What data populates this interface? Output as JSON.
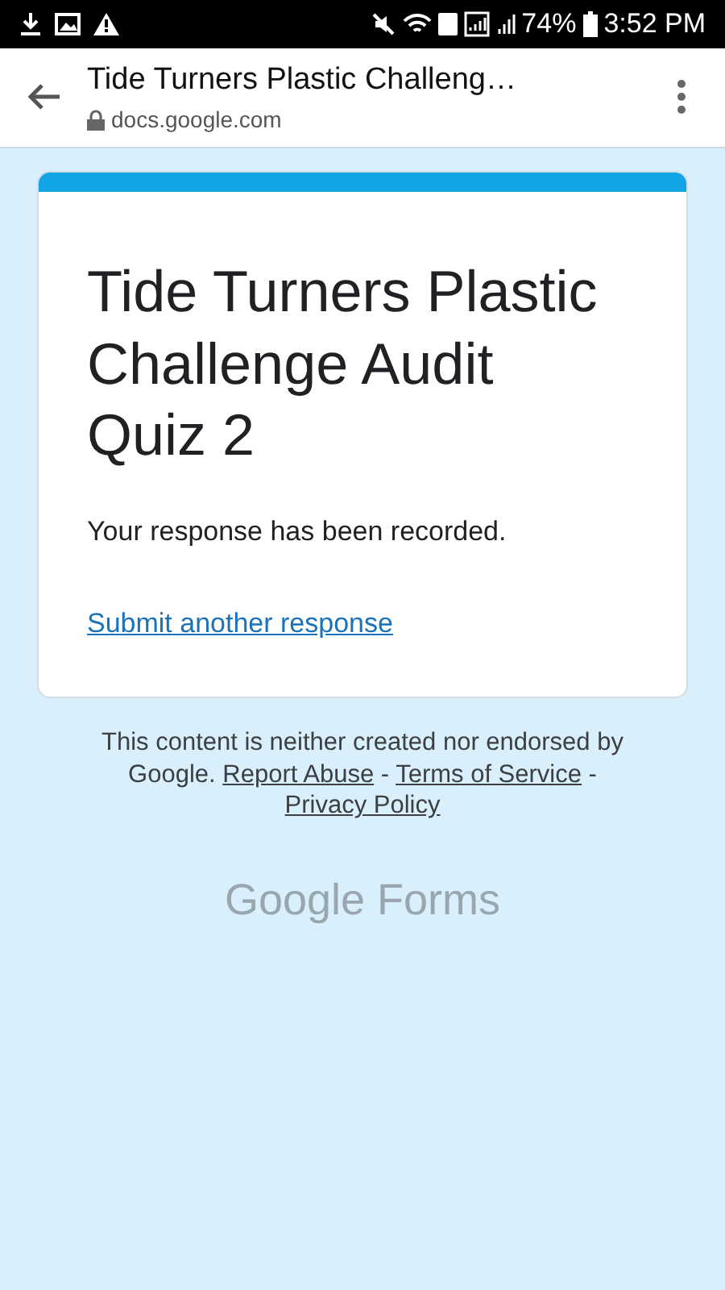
{
  "status_bar": {
    "battery": "74%",
    "time": "3:52 PM"
  },
  "browser": {
    "title": "Tide Turners Plastic Challeng…",
    "url": "docs.google.com"
  },
  "form": {
    "title": "Tide Turners Plastic Challenge Audit Quiz 2",
    "message": "Your response has been recorded.",
    "link": "Submit another response"
  },
  "footer": {
    "text": "This content is neither created nor endorsed by Google.",
    "links": [
      "Report Abuse",
      "Terms of Service",
      "Privacy Policy"
    ],
    "separator": "-",
    "logo": "Google Forms"
  }
}
